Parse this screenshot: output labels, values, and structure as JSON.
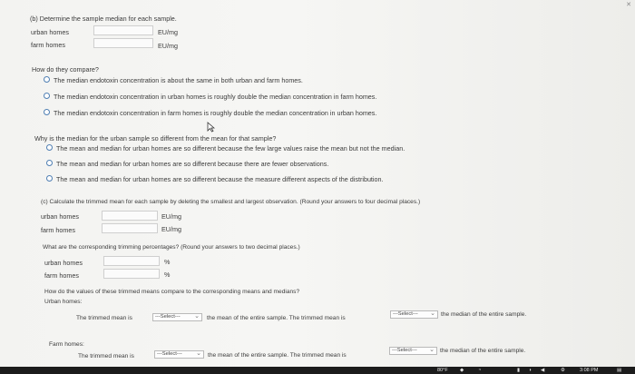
{
  "part_b": {
    "heading": "(b) Determine the sample median for each sample.",
    "urban_label": "urban homes",
    "farm_label": "farm homes",
    "unit": "EU/mg"
  },
  "compare_b": {
    "question": "How do they compare?",
    "options": [
      "The median endotoxin concentration is about the same in both urban and farm homes.",
      "The median endotoxin concentration in urban homes is roughly double the median concentration in farm homes.",
      "The median endotoxin concentration in farm homes is roughly double the median concentration in urban homes."
    ]
  },
  "why": {
    "question": "Why is the median for the urban sample so different from the mean for that sample?",
    "options": [
      "The mean and median for urban homes are so different because the few large values raise the mean but not the median.",
      "The mean and median for urban homes are so different because there are fewer observations.",
      "The mean and median for urban homes are so different because the measure different aspects of the distribution."
    ]
  },
  "part_c": {
    "heading": "(c) Calculate the trimmed mean for each sample by deleting the smallest and largest observation. (Round your answers to four decimal places.)",
    "urban_label": "urban homes",
    "farm_label": "farm homes",
    "unit": "EU/mg",
    "pct_question": "What are the corresponding trimming percentages? (Round your answers to two decimal places.)",
    "pct_urban_label": "urban homes",
    "pct_farm_label": "farm homes",
    "pct_unit": "%"
  },
  "compare_c": {
    "question": "How do the values of these trimmed means compare to the corresponding means and medians?",
    "urban_heading": "Urban homes:",
    "farm_heading": "Farm homes:",
    "sentence_a": "The trimmed mean is",
    "sentence_b": "the mean of the entire sample. The trimmed mean is",
    "sentence_c": "the median of the entire sample.",
    "select_placeholder": "---Select---"
  },
  "taskbar": {
    "temperature": "80°F",
    "time": "3:08 PM"
  }
}
